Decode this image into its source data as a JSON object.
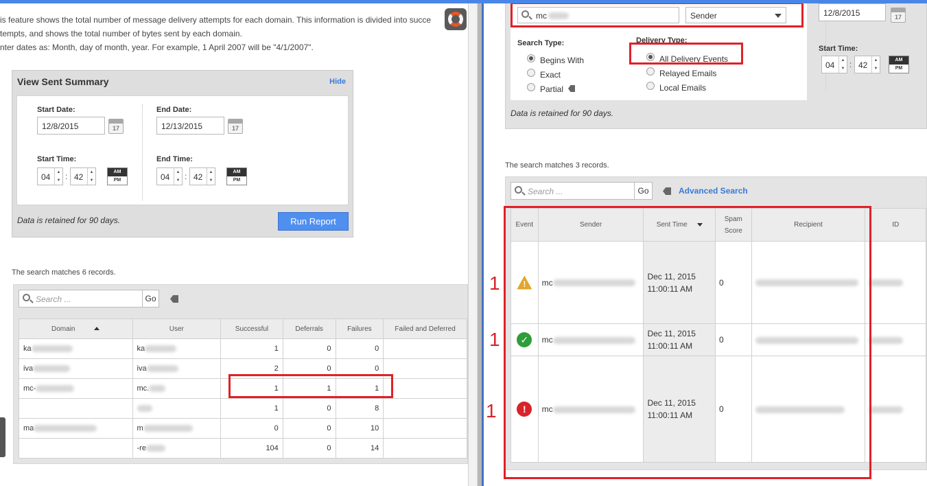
{
  "left": {
    "intro_lines": [
      "is feature shows the total number of message delivery attempts for each domain. This information is divided into succe",
      "tempts, and shows the total number of bytes sent by each domain.",
      "nter dates as: Month, day of month, year. For example, 1 April 2007 will be \"4/1/2007\"."
    ],
    "summary": {
      "title": "View Sent Summary",
      "hide_label": "Hide",
      "start_date_label": "Start Date:",
      "start_date": "12/8/2015",
      "end_date_label": "End Date:",
      "end_date": "12/13/2015",
      "calendar_day": "17",
      "start_time_label": "Start Time:",
      "end_time_label": "End Time:",
      "start_hour": "04",
      "start_minute": "42",
      "end_hour": "04",
      "end_minute": "42",
      "am": "AM",
      "pm": "PM",
      "retention_note": "Data is retained for 90 days.",
      "run_button": "Run Report"
    },
    "matches_text": "The search matches 6 records.",
    "search_placeholder": "Search ...",
    "go_label": "Go",
    "table": {
      "headers": [
        "Domain",
        "User",
        "Successful",
        "Deferrals",
        "Failures",
        "Failed and Deferred"
      ],
      "rows": [
        {
          "domain": "ka",
          "user": "ka",
          "successful": "1",
          "deferrals": "0",
          "failures": "0"
        },
        {
          "domain": "iva",
          "user": "iva",
          "successful": "2",
          "deferrals": "0",
          "failures": "0"
        },
        {
          "domain": "mc-",
          "user": "mc.",
          "successful": "1",
          "deferrals": "1",
          "failures": "1"
        },
        {
          "domain": "",
          "user": "",
          "successful": "1",
          "deferrals": "0",
          "failures": "8"
        },
        {
          "domain": "ma",
          "user": "m",
          "successful": "0",
          "deferrals": "0",
          "failures": "10"
        },
        {
          "domain": "",
          "user": "-re",
          "successful": "104",
          "deferrals": "0",
          "failures": "14"
        }
      ]
    }
  },
  "right": {
    "search_value": "mc",
    "field_select": "Sender",
    "date_value": "12/8/2015",
    "calendar_day": "17",
    "search_type_label": "Search Type:",
    "search_types": [
      "Begins With",
      "Exact",
      "Partial"
    ],
    "delivery_type_label": "Delivery Type:",
    "delivery_types": [
      "All Delivery Events",
      "Relayed Emails",
      "Local Emails"
    ],
    "start_time_label": "Start Time:",
    "start_hour": "04",
    "start_minute": "42",
    "am": "AM",
    "pm": "PM",
    "retention_note": "Data is retained for 90 days.",
    "matches_text": "The search matches 3 records.",
    "search_placeholder": "Search ...",
    "go_label": "Go",
    "advanced_search": "Advanced Search",
    "table": {
      "headers": [
        "Event",
        "Sender",
        "Sent Time",
        "Spam Score",
        "Recipient",
        "ID"
      ],
      "rows": [
        {
          "event_icon": "warning-icon",
          "sender": "mc",
          "sent_date": "Dec 11, 2015",
          "sent_time": "11:00:11 AM",
          "spam": "0",
          "recipient": "",
          "annotation": "1"
        },
        {
          "event_icon": "success-icon",
          "sender": "mc",
          "sent_date": "Dec 11, 2015",
          "sent_time": "11:00:11 AM",
          "spam": "0",
          "recipient": "",
          "annotation": "1"
        },
        {
          "event_icon": "error-icon",
          "sender": "mc",
          "sent_date": "Dec 11, 2015",
          "sent_time": "11:00:11 AM",
          "spam": "0",
          "recipient": "",
          "annotation": "1"
        }
      ]
    }
  },
  "colors": {
    "accent_blue": "#4a86e8",
    "link_blue": "#3a78d8",
    "annotation_red": "#e02027",
    "warning": "#e3a62a",
    "success": "#2f9d3a",
    "error": "#d8232a"
  }
}
